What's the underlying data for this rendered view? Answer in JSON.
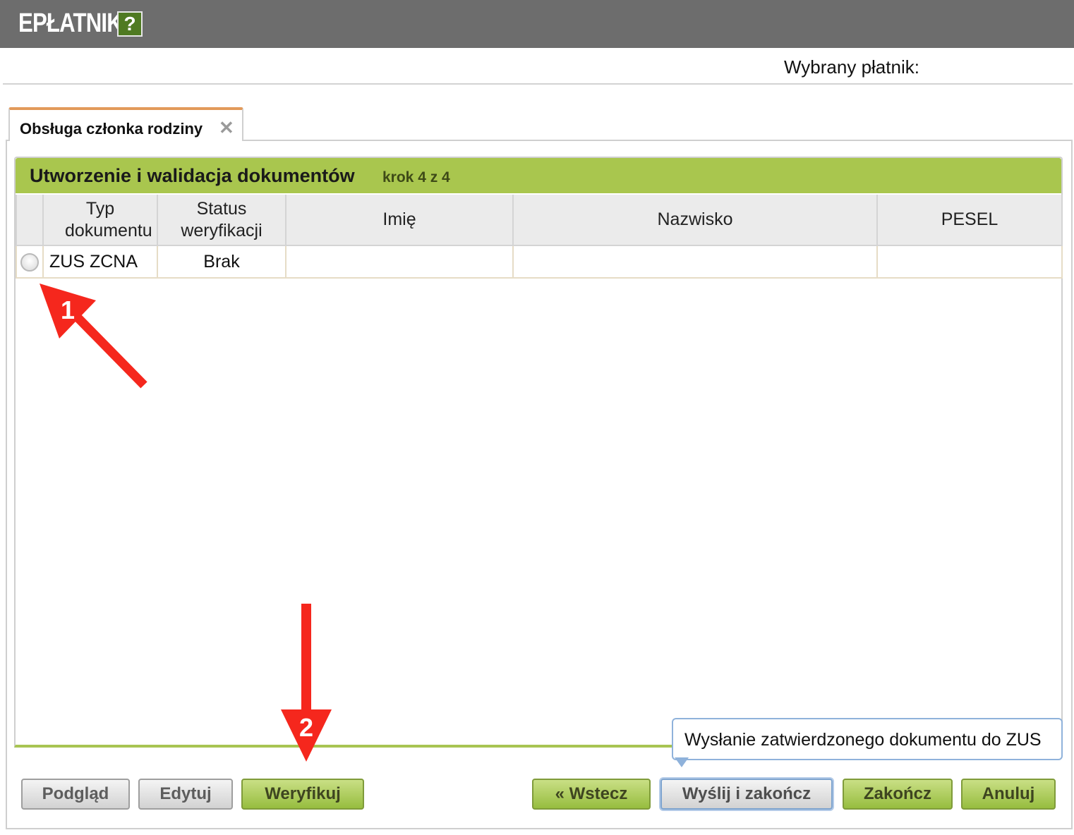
{
  "app": {
    "title": "EPŁATNIK",
    "help_label": "?"
  },
  "header": {
    "payer_label": "Wybrany płatnik:"
  },
  "tabs": [
    {
      "label": "Obsługa członka rodziny",
      "close": "✕"
    }
  ],
  "grid": {
    "title": "Utworzenie i walidacja dokumentów",
    "step": "krok 4 z 4",
    "columns": [
      "",
      "Typ dokumentu",
      "Status weryfikacji",
      "Imię",
      "Nazwisko",
      "PESEL"
    ],
    "rows": [
      {
        "typ": "ZUS ZCNA",
        "status": "Brak",
        "imie": "",
        "nazwisko": "",
        "pesel": ""
      }
    ]
  },
  "buttons": {
    "preview": "Podgląd",
    "edit": "Edytuj",
    "verify": "Weryfikuj",
    "back": "« Wstecz",
    "send_finish": "Wyślij i zakończ",
    "finish": "Zakończ",
    "cancel": "Anuluj"
  },
  "tooltip": "Wysłanie zatwierdzonego dokumentu do ZUS",
  "annotations": {
    "first": "1",
    "second": "2",
    "arrow_color": "#f5271d"
  }
}
